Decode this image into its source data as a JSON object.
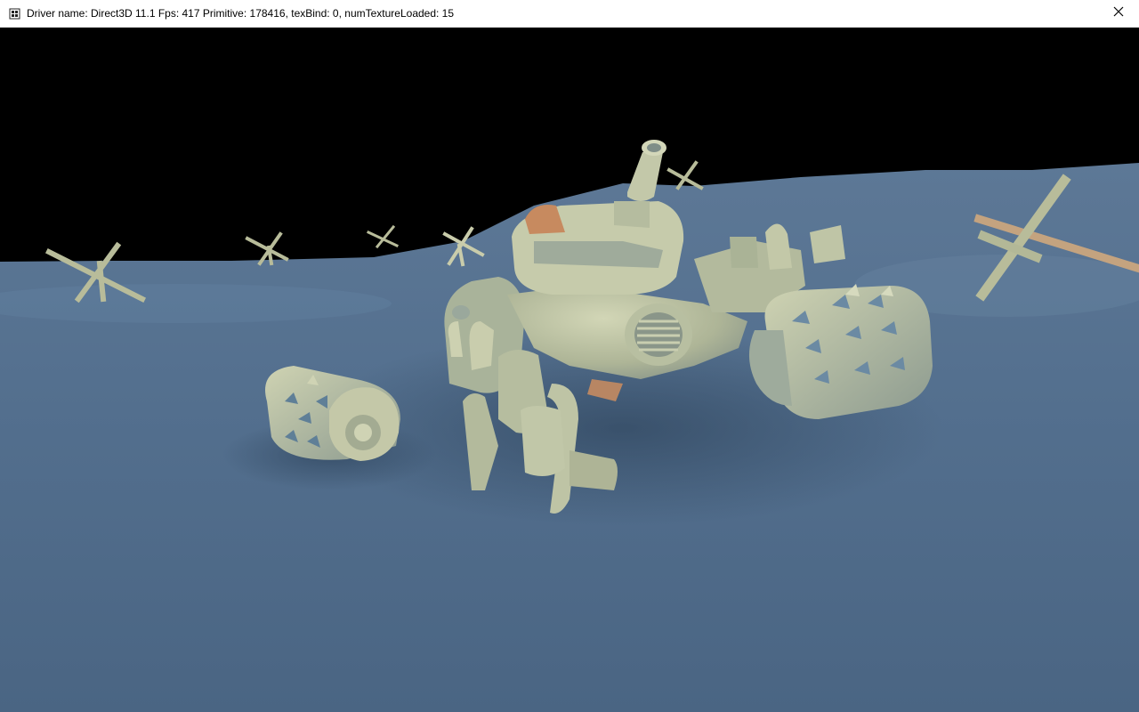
{
  "window": {
    "title": "Driver name: Direct3D 11.1 Fps: 417 Primitive: 178416, texBind: 0, numTextureLoaded: 15",
    "icon": "app-window-icon",
    "close_icon": "close-icon"
  },
  "scene": {
    "sky_color": "#000000",
    "terrain_color": "#4e6a88",
    "model_color": "#b9bf9e"
  }
}
